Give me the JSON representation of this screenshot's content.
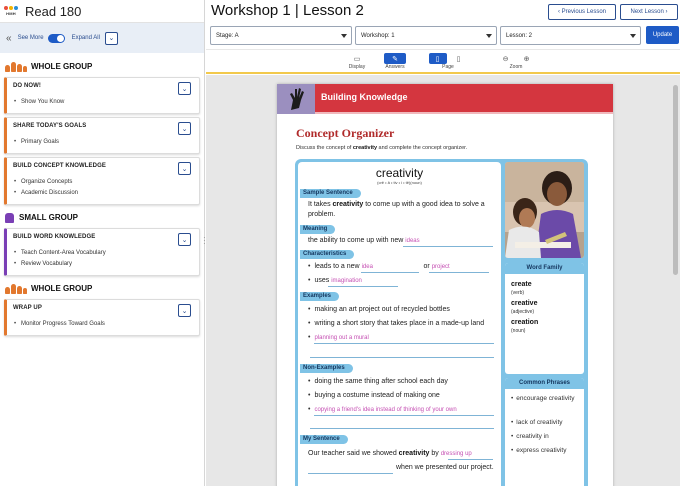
{
  "app": {
    "title": "Read 180",
    "logo_text": "HMH"
  },
  "sidebar": {
    "see_more_label": "See More",
    "expand_all_label": "Expand All",
    "groups": [
      {
        "title": "WHOLE GROUP",
        "cards": [
          {
            "title": "DO NOW!",
            "items": [
              "Show You Know"
            ]
          },
          {
            "title": "SHARE TODAY'S GOALS",
            "items": [
              "Primary Goals"
            ]
          },
          {
            "title": "BUILD CONCEPT KNOWLEDGE",
            "items": [
              "Organize Concepts",
              "Academic Discussion"
            ]
          }
        ]
      },
      {
        "title": "SMALL GROUP",
        "cards": [
          {
            "title": "BUILD WORD KNOWLEDGE",
            "items": [
              "Teach Content-Area Vocabulary",
              "Review Vocabulary"
            ]
          }
        ]
      },
      {
        "title": "WHOLE GROUP",
        "cards": [
          {
            "title": "WRAP UP",
            "items": [
              "Monitor Progress Toward Goals"
            ]
          }
        ]
      }
    ]
  },
  "header": {
    "title": "Workshop 1 | Lesson 2",
    "prev_label": "Previous Lesson",
    "next_label": "Next Lesson",
    "stage_select": "Stage: A",
    "workshop_select": "Workshop: 1",
    "lesson_select": "Lesson: 2",
    "update_label": "Update"
  },
  "toolbar": {
    "display_label": "Display",
    "answers_label": "Answers",
    "page_label": "Page",
    "zoom_label": "Zoom"
  },
  "document": {
    "band_title": "Building Knowledge",
    "title": "Concept Organizer",
    "subtitle_pre": "Discuss the concept of ",
    "subtitle_bold": "creativity",
    "subtitle_post": " and complete the concept organizer.",
    "word": "creativity",
    "pronunciation": "(crē • ā • tiv • i • tē)(noun)",
    "sections": {
      "sample_sentence": "Sample Sentence",
      "meaning": "Meaning",
      "characteristics": "Characteristics",
      "examples": "Examples",
      "non_examples": "Non-Examples",
      "my_sentence": "My Sentence"
    },
    "sample_pre": "It takes ",
    "sample_bold": "creativity",
    "sample_post": " to come up with a good idea to solve a problem.",
    "meaning_text": "the ability to come up with new",
    "meaning_answer": "ideas",
    "char1_pre": "leads to a new",
    "char1_answer1": "idea",
    "char1_or": "or",
    "char1_answer2": "project",
    "char2_pre": "uses",
    "char2_answer": "imagination",
    "ex1": "making an art project out of recycled bottles",
    "ex2": "writing a short story that takes place in a made-up land",
    "ex3_answer": "planning out a mural",
    "non1": "doing the same thing after school each day",
    "non2": "buying a costume instead of making one",
    "non3_answer": "copying a friend's idea instead of thinking of your own",
    "mys_pre": "Our teacher said we showed ",
    "mys_bold": "creativity",
    "mys_by": " by",
    "mys_answer": "dressing up",
    "mys_post": "when we presented our project.",
    "word_family_title": "Word Family",
    "word_family": [
      {
        "word": "create",
        "pos": "(verb)"
      },
      {
        "word": "creative",
        "pos": "(adjective)"
      },
      {
        "word": "creation",
        "pos": "(noun)"
      }
    ],
    "common_phrases_title": "Common Phrases",
    "common_phrases": [
      "encourage creativity",
      "lack of creativity",
      "creativity in",
      "express creativity"
    ]
  },
  "colors": {
    "accent": "#1e5bc6",
    "whole_group": "#e2782e",
    "small_group": "#7a3fb5",
    "band_red": "#d4363f",
    "organizer_blue": "#7fc3e6",
    "answer_pink": "#c54fb3"
  }
}
